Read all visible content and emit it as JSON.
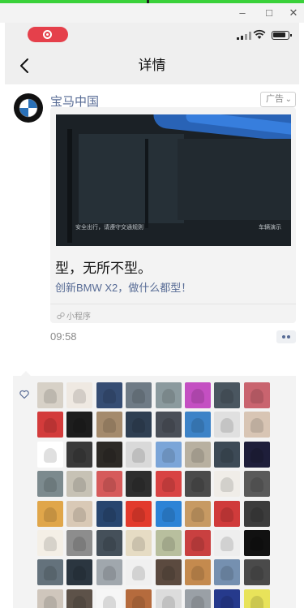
{
  "window": {
    "minimize_glyph": "–",
    "maximize_glyph": "□",
    "close_glyph": "✕"
  },
  "status_bar": {
    "recording_active": true,
    "signal_icon": "signal-bars-icon",
    "wifi_icon": "wifi-icon",
    "battery_icon": "battery-icon"
  },
  "nav": {
    "title": "详情",
    "back_icon": "chevron-left-icon"
  },
  "post": {
    "author": "宝马中国",
    "avatar_icon": "bmw-logo-icon",
    "ad_label": "广告",
    "video": {
      "caption_left": "安全出行，请遵守交通规则",
      "caption_right": "车辆演示"
    },
    "headline": "型，无所不型。",
    "subline": "创新BMW X2，做什么都型！",
    "mini_program_label": "小程序",
    "time": "09:58"
  },
  "likes": {
    "heart_icon": "heart-icon",
    "avatar_colors": [
      [
        "#d7d1c7",
        "#efe9e2",
        "#364d73",
        "#6f7b86",
        "#8b9a9e",
        "#c44fc2",
        "#4a5660",
        "#c9646f"
      ],
      [
        "#d33b3b",
        "#1d1d1d",
        "#a48a6c",
        "#2f3f52",
        "#4a4f58",
        "#3d83c7",
        "#e0e0e0",
        "#d8c5b4"
      ],
      [
        "#ffffff",
        "#3a3a3a",
        "#2d2a26",
        "#d9d9d9",
        "#7ba5d8",
        "#b8b0a0",
        "#3d4a56",
        "#1e1e3a"
      ],
      [
        "#7c8a8e",
        "#c7c2b5",
        "#d65b5b",
        "#2e2e2e",
        "#d84343",
        "#4b4b4b",
        "#f0ede8",
        "#5a5a5a"
      ],
      [
        "#e0a64a",
        "#d9c9b6",
        "#28466f",
        "#e23a2c",
        "#2d83d6",
        "#c79a63",
        "#d03b3b",
        "#3c3c3c"
      ],
      [
        "#f4efe6",
        "#8d8d8d",
        "#45505a",
        "#e6dcc4",
        "#b8bf9e",
        "#c94040",
        "#eeeeee",
        "#111111"
      ],
      [
        "#64727c",
        "#2b3640",
        "#a0a7ad",
        "#f0f0f0",
        "#5b4a3f",
        "#c48a4e",
        "#7590b0",
        "#4a4a4a"
      ],
      [
        "#cfc6bc",
        "#5d5249",
        "#f6f6f6",
        "#b56b3d",
        "#dcdcdc",
        "#9aa0a6",
        "#263a8c",
        "#e8e35a"
      ]
    ]
  }
}
